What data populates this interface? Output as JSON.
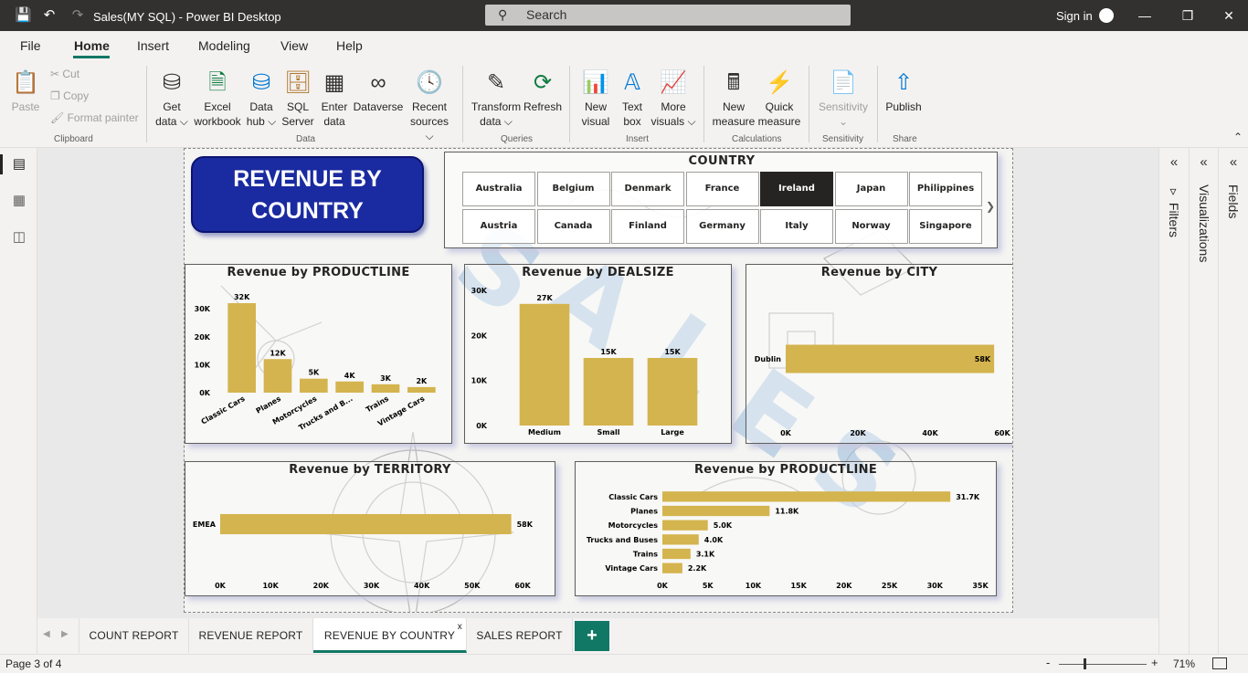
{
  "window": {
    "title": "Sales(MY SQL) - Power BI Desktop",
    "search_placeholder": "Search",
    "sign_in": "Sign in"
  },
  "menu": [
    "File",
    "Home",
    "Insert",
    "Modeling",
    "View",
    "Help"
  ],
  "ribbon": {
    "clipboard": {
      "paste": "Paste",
      "cut": "Cut",
      "copy": "Copy",
      "format_painter": "Format painter",
      "group": "Clipboard"
    },
    "data": {
      "get_data_1": "Get",
      "get_data_2": "data ⌵",
      "excel_1": "Excel",
      "excel_2": "workbook",
      "hub_1": "Data",
      "hub_2": "hub ⌵",
      "sql_1": "SQL",
      "sql_2": "Server",
      "enter_1": "Enter",
      "enter_2": "data",
      "dataverse": "Dataverse",
      "recent_1": "Recent",
      "recent_2": "sources ⌵",
      "group": "Data"
    },
    "queries": {
      "transform_1": "Transform",
      "transform_2": "data ⌵",
      "refresh": "Refresh",
      "group": "Queries"
    },
    "insert": {
      "new_visual_1": "New",
      "new_visual_2": "visual",
      "text_box_1": "Text",
      "text_box_2": "box",
      "more_visuals_1": "More",
      "more_visuals_2": "visuals ⌵",
      "group": "Insert"
    },
    "calculations": {
      "new_measure_1": "New",
      "new_measure_2": "measure",
      "quick_measure_1": "Quick",
      "quick_measure_2": "measure",
      "group": "Calculations"
    },
    "sensitivity": {
      "label": "Sensitivity",
      "group": "Sensitivity"
    },
    "share": {
      "publish": "Publish",
      "group": "Share"
    }
  },
  "report": {
    "title_line1": "REVENUE BY",
    "title_line2": "COUNTRY",
    "slicer": {
      "title": "COUNTRY",
      "row1": [
        "Australia",
        "Belgium",
        "Denmark",
        "France",
        "Ireland",
        "Japan",
        "Philippines"
      ],
      "row2": [
        "Austria",
        "Canada",
        "Finland",
        "Germany",
        "Italy",
        "Norway",
        "Singapore"
      ],
      "selected": "Ireland"
    }
  },
  "panes": {
    "filters": "Filters",
    "visualizations": "Visualizations",
    "fields": "Fields"
  },
  "tabs": [
    "COUNT REPORT",
    "REVENUE REPORT",
    "REVENUE BY COUNTRY",
    "SALES REPORT"
  ],
  "active_tab": "REVENUE BY COUNTRY",
  "tab_close": "x",
  "add_tab": "+",
  "status": {
    "page": "Page 3 of 4",
    "zoom": "71%",
    "minus": "-",
    "plus": "+"
  },
  "colors": {
    "bar": "#d4b44e",
    "title_box": "#1a2aa0",
    "accent": "#117865"
  },
  "chart_data": [
    {
      "type": "bar",
      "title": "Revenue by PRODUCTLINE",
      "categories": [
        "Classic Cars",
        "Planes",
        "Motorcycles",
        "Trucks and B...",
        "Trains",
        "Vintage Cars"
      ],
      "values": [
        32000,
        12000,
        5000,
        4000,
        3000,
        2000
      ],
      "data_labels": [
        "32K",
        "12K",
        "5K",
        "4K",
        "3K",
        "2K"
      ],
      "yticks": [
        "0K",
        "10K",
        "20K",
        "30K"
      ],
      "ylim": [
        0,
        32000
      ]
    },
    {
      "type": "bar",
      "title": "Revenue by DEALSIZE",
      "categories": [
        "Medium",
        "Small",
        "Large"
      ],
      "values": [
        27000,
        15000,
        15000
      ],
      "data_labels": [
        "27K",
        "15K",
        "15K"
      ],
      "yticks": [
        "0K",
        "10K",
        "20K",
        "30K"
      ],
      "ylim": [
        0,
        30000
      ]
    },
    {
      "type": "bar",
      "orientation": "horizontal",
      "title": "Revenue by CITY",
      "categories": [
        "Dublin"
      ],
      "values": [
        57756
      ],
      "data_labels": [
        "58K"
      ],
      "xticks": [
        "0K",
        "20K",
        "40K",
        "60K"
      ],
      "xlim": [
        0,
        60000
      ]
    },
    {
      "type": "bar",
      "orientation": "horizontal",
      "title": "Revenue by TERRITORY",
      "categories": [
        "EMEA"
      ],
      "values": [
        57756
      ],
      "data_labels": [
        "58K"
      ],
      "xticks": [
        "0K",
        "10K",
        "20K",
        "30K",
        "40K",
        "50K",
        "60K"
      ],
      "xlim": [
        0,
        60000
      ]
    },
    {
      "type": "bar",
      "orientation": "horizontal",
      "title": "Revenue by PRODUCTLINE",
      "categories": [
        "Classic Cars",
        "Planes",
        "Motorcycles",
        "Trucks and Buses",
        "Trains",
        "Vintage Cars"
      ],
      "values": [
        31700,
        11800,
        5000,
        4000,
        3100,
        2200
      ],
      "data_labels": [
        "31.7K",
        "11.8K",
        "5.0K",
        "4.0K",
        "3.1K",
        "2.2K"
      ],
      "xticks": [
        "0K",
        "5K",
        "10K",
        "15K",
        "20K",
        "25K",
        "30K",
        "35K"
      ],
      "xlim": [
        0,
        35000
      ]
    }
  ]
}
